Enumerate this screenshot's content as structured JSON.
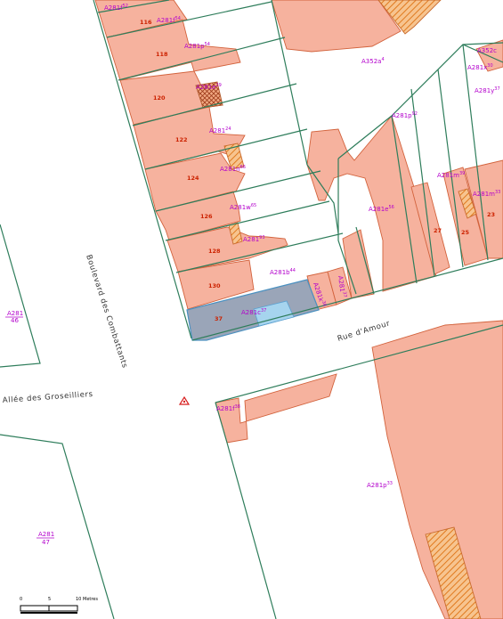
{
  "streets": {
    "boulevard": "Boulevard des Combattants",
    "rue_amour": "Rue d'Amour",
    "allee": "Allée des Groseilliers"
  },
  "house_numbers": [
    "116",
    "118",
    "120",
    "122",
    "124",
    "126",
    "128",
    "130",
    "37",
    "27",
    "25",
    "23"
  ],
  "parcels": [
    {
      "base": "A281f",
      "sup": "52"
    },
    {
      "base": "A281f",
      "sup": "54"
    },
    {
      "base": "A281p",
      "sup": "54"
    },
    {
      "base": "A281e",
      "sup": "29"
    },
    {
      "base": "A281",
      "sup": "24"
    },
    {
      "base": "A281n",
      "sup": "66"
    },
    {
      "base": "A281w",
      "sup": "65"
    },
    {
      "base": "A281",
      "sup": "93"
    },
    {
      "base": "A281b",
      "sup": "44"
    },
    {
      "base": "A281k",
      "sup": "36"
    },
    {
      "base": "A281c",
      "sup": "37"
    },
    {
      "base": "A281",
      "sup": "37"
    },
    {
      "base": "A352a",
      "sup": "4"
    },
    {
      "base": "A352c",
      "sup": ""
    },
    {
      "base": "A281x",
      "sup": "30"
    },
    {
      "base": "A281y",
      "sup": "37"
    },
    {
      "base": "A281p",
      "sup": "92"
    },
    {
      "base": "A281m",
      "sup": "39"
    },
    {
      "base": "A281m",
      "sup": "33"
    },
    {
      "base": "A281e",
      "sup": "56"
    },
    {
      "base": "A281f",
      "sup": "38"
    },
    {
      "base": "A281p",
      "sup": "33"
    }
  ],
  "sections": [
    {
      "top": "A281",
      "bottom": "46"
    },
    {
      "top": "A281",
      "bottom": "47"
    }
  ],
  "scale_bar": {
    "ticks": [
      "0",
      "5",
      "10"
    ],
    "unit": "Metres"
  },
  "colors": {
    "building": "#f6b29e",
    "building_stroke": "#d2623c",
    "parcel_line": "#2e7d5b",
    "selected_parcel": "#9aa5b8",
    "selected_building": "#a6d4ee",
    "label_purple": "#b300cc",
    "number_red": "#cc2200",
    "hatch": "#e07a1f"
  },
  "icons": [
    "point-marker-icon"
  ]
}
